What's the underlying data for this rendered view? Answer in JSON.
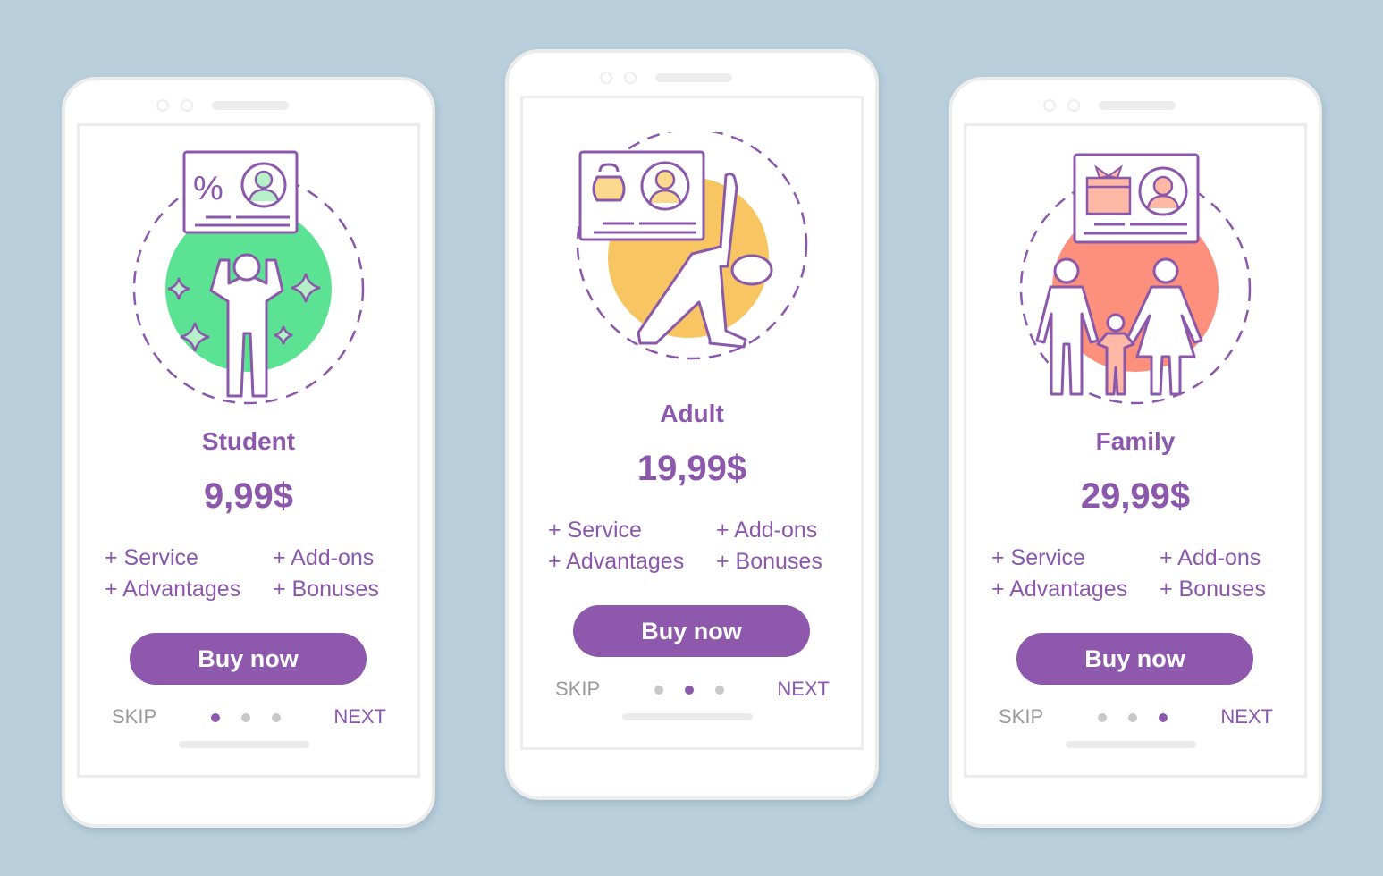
{
  "colors": {
    "background": "#b9d0dc",
    "accent": "#8b58ab",
    "student_circle": "#5be292",
    "adult_circle": "#f7c561",
    "family_circle": "#fd8f7d"
  },
  "plans": [
    {
      "illustration": "student-strong-person-with-discount-card",
      "name": "Student",
      "price": "9,99$",
      "features": [
        "+ Service",
        "+ Add-ons",
        "+ Advantages",
        "+ Bonuses"
      ],
      "buy_label": "Buy now",
      "skip_label": "SKIP",
      "next_label": "NEXT",
      "page_index": 1,
      "page_count": 3
    },
    {
      "illustration": "adult-yoga-pose-with-fitness-card",
      "name": "Adult",
      "price": "19,99$",
      "features": [
        "+ Service",
        "+ Add-ons",
        "+ Advantages",
        "+ Bonuses"
      ],
      "buy_label": "Buy now",
      "skip_label": "SKIP",
      "next_label": "NEXT",
      "page_index": 2,
      "page_count": 3
    },
    {
      "illustration": "family-with-gift-card",
      "name": "Family",
      "price": "29,99$",
      "features": [
        "+ Service",
        "+ Add-ons",
        "+ Advantages",
        "+ Bonuses"
      ],
      "buy_label": "Buy now",
      "skip_label": "SKIP",
      "next_label": "NEXT",
      "page_index": 3,
      "page_count": 3
    }
  ]
}
